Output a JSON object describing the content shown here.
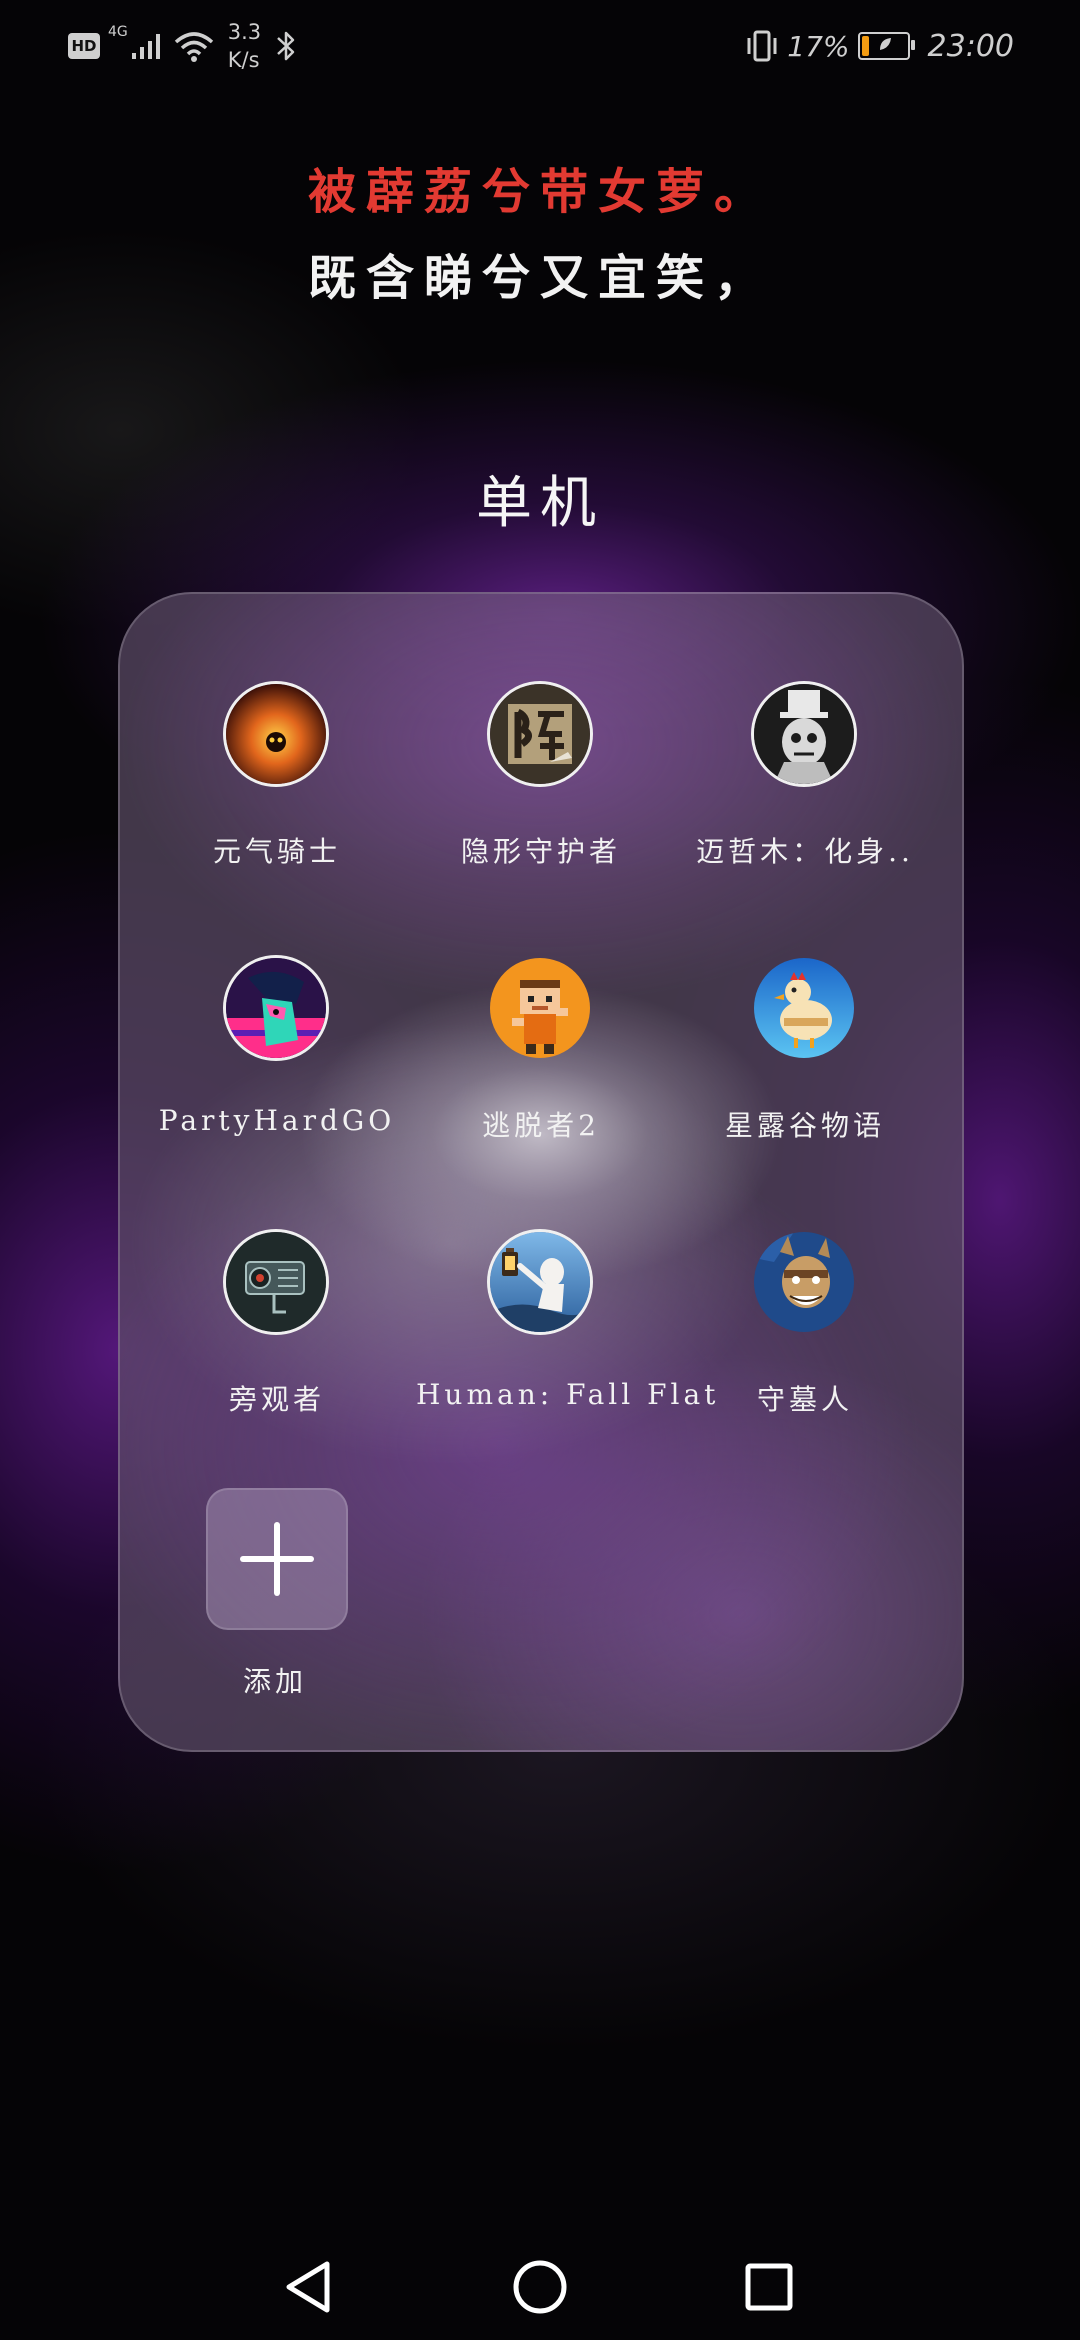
{
  "status_bar": {
    "hd": "HD",
    "network_type": "4G",
    "speed_value": "3.3",
    "speed_unit": "K/s",
    "battery_percent": "17%",
    "battery_level": 0.17,
    "battery_color": "#f39c12",
    "time": "23:00",
    "icons": [
      "signal-icon",
      "wifi-icon",
      "bluetooth-icon",
      "vibrate-icon",
      "battery-icon",
      "leaf-icon"
    ]
  },
  "poem": {
    "line1": "被薜荔兮带女萝。",
    "line2": "既含睇兮又宜笑，",
    "line1_color": "#e23a32",
    "line2_color": "#f2f2f2"
  },
  "folder": {
    "title": "单机",
    "apps": [
      {
        "label": "元气骑士",
        "icon": "soul-knight-icon"
      },
      {
        "label": "隐形守护者",
        "icon": "invisible-guardian-icon"
      },
      {
        "label": "迈哲木：化身..",
        "icon": "maze-mu-icon"
      },
      {
        "label": "PartyHardGO",
        "icon": "party-hard-go-icon"
      },
      {
        "label": "逃脱者2",
        "icon": "escapists-2-icon"
      },
      {
        "label": "星露谷物语",
        "icon": "stardew-valley-icon"
      },
      {
        "label": "旁观者",
        "icon": "beholder-icon"
      },
      {
        "label": "Human: Fall Flat",
        "icon": "human-fall-flat-icon"
      },
      {
        "label": "守墓人",
        "icon": "graveyard-keeper-icon"
      }
    ],
    "add_label": "添加"
  },
  "nav_bar": {
    "buttons": [
      "back-icon",
      "home-icon",
      "recent-apps-icon"
    ]
  }
}
